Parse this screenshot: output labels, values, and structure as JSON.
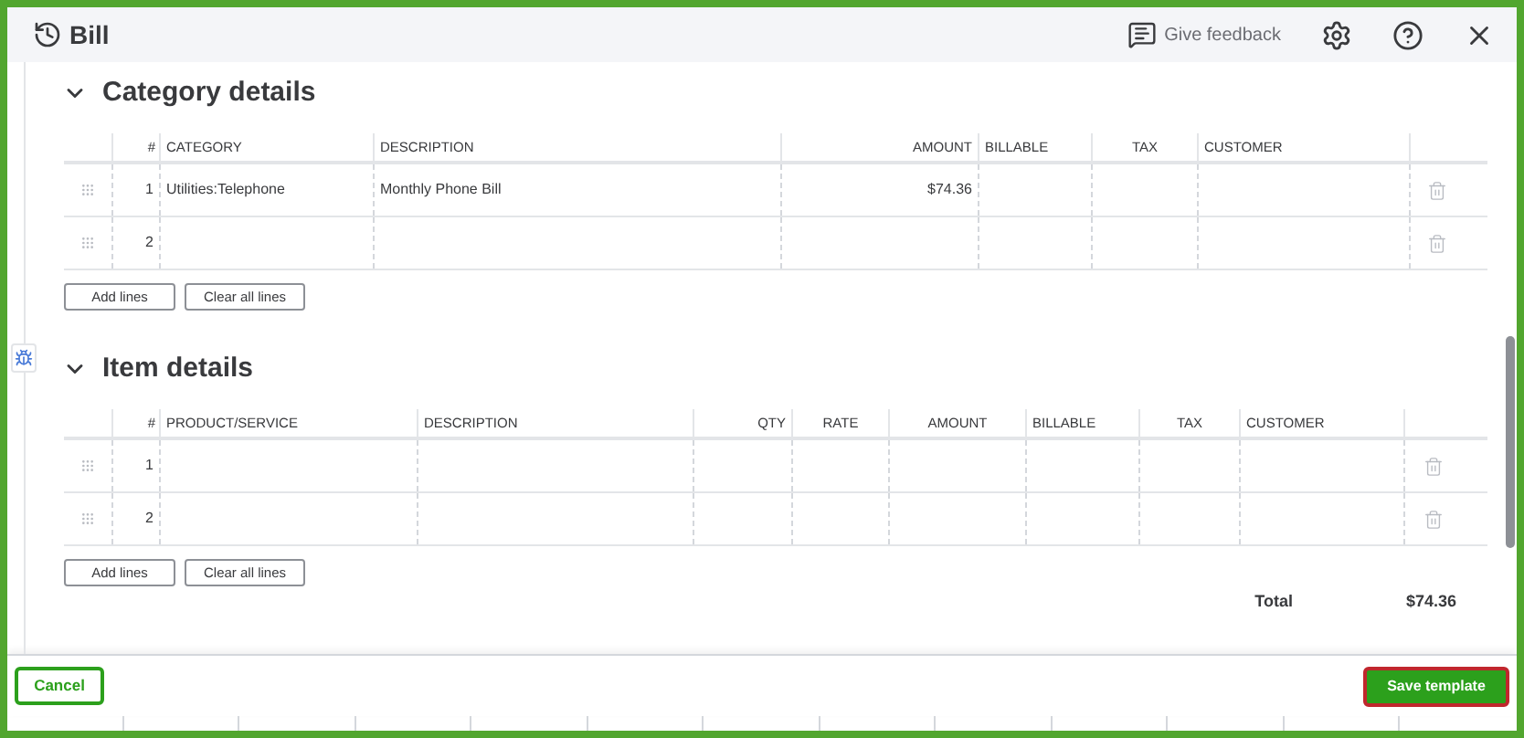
{
  "window": {
    "title": "Bill"
  },
  "header_actions": {
    "feedback": "Give feedback"
  },
  "sections": [
    {
      "title": "Category details",
      "expanded": true,
      "columns": [
        "#",
        "CATEGORY",
        "DESCRIPTION",
        "AMOUNT",
        "BILLABLE",
        "TAX",
        "CUSTOMER"
      ],
      "rows": [
        {
          "cells": [
            "1",
            "Utilities:Telephone",
            "Monthly Phone Bill",
            "$74.36",
            "",
            "",
            ""
          ]
        },
        {
          "cells": [
            "2",
            "",
            "",
            "",
            "",
            "",
            ""
          ]
        }
      ],
      "buttons": [
        "Add lines",
        "Clear all lines"
      ]
    },
    {
      "title": "Item details",
      "expanded": true,
      "columns": [
        "#",
        "PRODUCT/SERVICE",
        "DESCRIPTION",
        "QTY",
        "RATE",
        "AMOUNT",
        "BILLABLE",
        "TAX",
        "CUSTOMER"
      ],
      "rows": [
        {
          "cells": [
            "1",
            "",
            "",
            "",
            "",
            "",
            "",
            "",
            ""
          ]
        },
        {
          "cells": [
            "2",
            "",
            "",
            "",
            "",
            "",
            "",
            "",
            ""
          ]
        }
      ],
      "buttons": [
        "Add lines",
        "Clear all lines"
      ]
    }
  ],
  "total": {
    "label": "Total",
    "value": "$74.36"
  },
  "footer": {
    "cancel": "Cancel",
    "save": "Save template"
  }
}
